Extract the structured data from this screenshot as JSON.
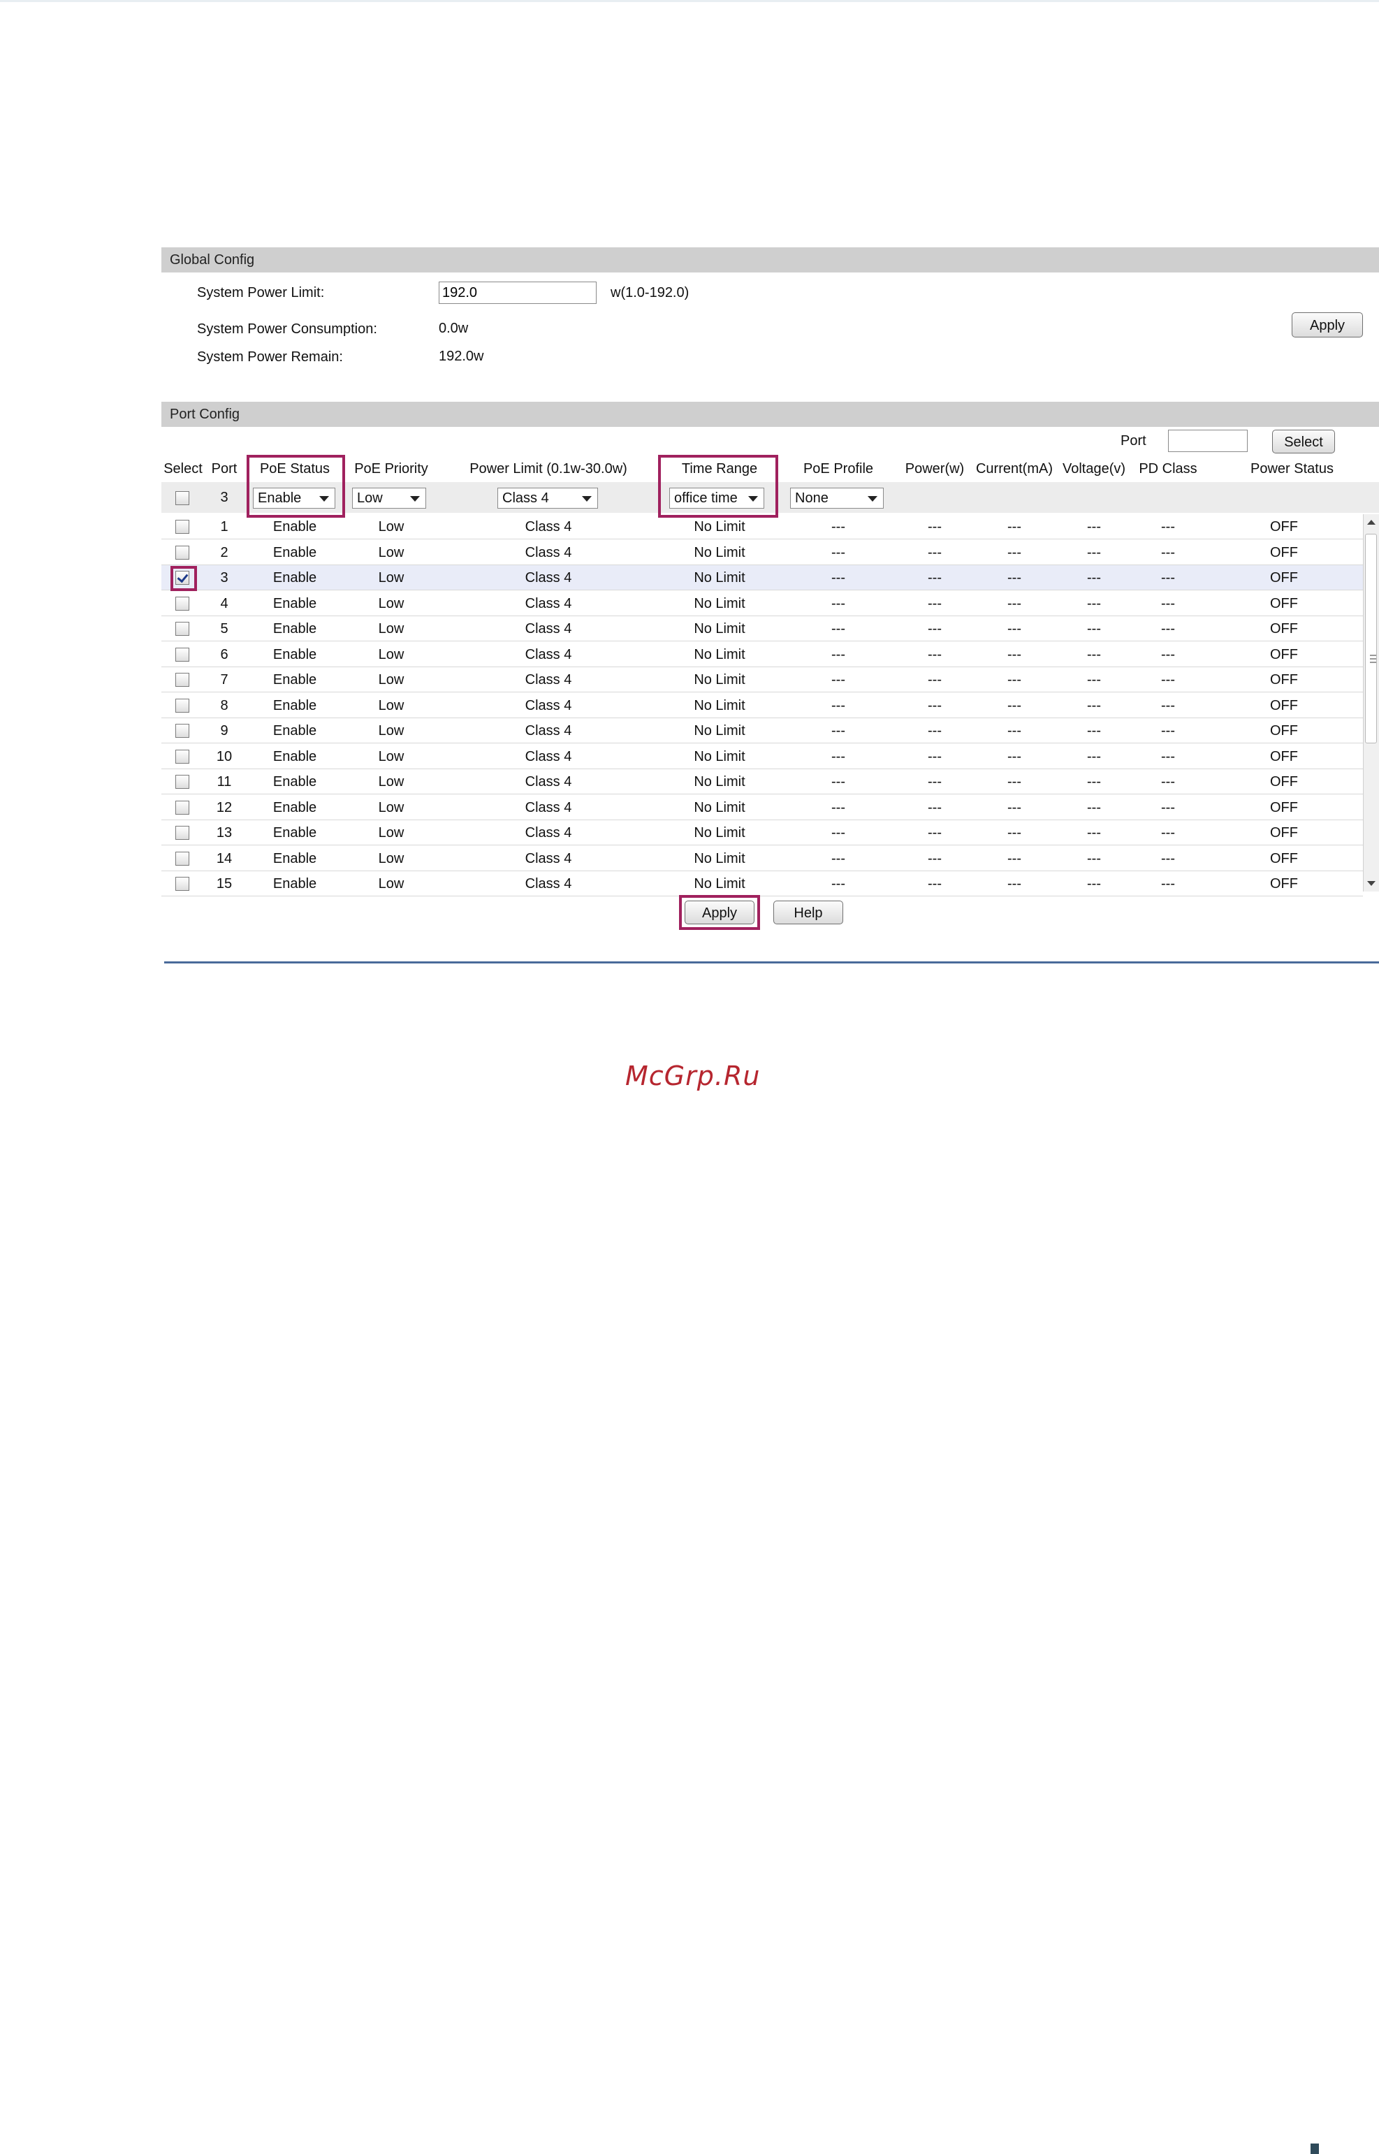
{
  "global_config": {
    "header": "Global Config",
    "system_power_limit_label": "System Power Limit:",
    "system_power_limit_value": "192.0",
    "system_power_limit_range": "w(1.0-192.0)",
    "system_power_consumption_label": "System Power Consumption:",
    "system_power_consumption_value": "0.0w",
    "system_power_remain_label": "System Power Remain:",
    "system_power_remain_value": "192.0w",
    "apply_label": "Apply"
  },
  "port_config": {
    "header": "Port Config",
    "port_filter_label": "Port",
    "port_filter_value": "",
    "select_label": "Select",
    "columns": [
      "Select",
      "Port",
      "PoE Status",
      "PoE Priority",
      "Power Limit (0.1w-30.0w)",
      "Time Range",
      "PoE Profile",
      "Power(w)",
      "Current(mA)",
      "Voltage(v)",
      "PD Class",
      "Power Status"
    ],
    "edit_row": {
      "port": "3",
      "poe_status": "Enable",
      "poe_priority": "Low",
      "power_limit": "Class 4",
      "time_range": "office time",
      "poe_profile": "None"
    },
    "rows": [
      {
        "port": "1",
        "status": "Enable",
        "priority": "Low",
        "limit": "Class 4",
        "time": "No Limit",
        "profile": "---",
        "power": "---",
        "current": "---",
        "voltage": "---",
        "pd_class": "---",
        "power_status": "OFF",
        "checked": false
      },
      {
        "port": "2",
        "status": "Enable",
        "priority": "Low",
        "limit": "Class 4",
        "time": "No Limit",
        "profile": "---",
        "power": "---",
        "current": "---",
        "voltage": "---",
        "pd_class": "---",
        "power_status": "OFF",
        "checked": false
      },
      {
        "port": "3",
        "status": "Enable",
        "priority": "Low",
        "limit": "Class 4",
        "time": "No Limit",
        "profile": "---",
        "power": "---",
        "current": "---",
        "voltage": "---",
        "pd_class": "---",
        "power_status": "OFF",
        "checked": true
      },
      {
        "port": "4",
        "status": "Enable",
        "priority": "Low",
        "limit": "Class 4",
        "time": "No Limit",
        "profile": "---",
        "power": "---",
        "current": "---",
        "voltage": "---",
        "pd_class": "---",
        "power_status": "OFF",
        "checked": false
      },
      {
        "port": "5",
        "status": "Enable",
        "priority": "Low",
        "limit": "Class 4",
        "time": "No Limit",
        "profile": "---",
        "power": "---",
        "current": "---",
        "voltage": "---",
        "pd_class": "---",
        "power_status": "OFF",
        "checked": false
      },
      {
        "port": "6",
        "status": "Enable",
        "priority": "Low",
        "limit": "Class 4",
        "time": "No Limit",
        "profile": "---",
        "power": "---",
        "current": "---",
        "voltage": "---",
        "pd_class": "---",
        "power_status": "OFF",
        "checked": false
      },
      {
        "port": "7",
        "status": "Enable",
        "priority": "Low",
        "limit": "Class 4",
        "time": "No Limit",
        "profile": "---",
        "power": "---",
        "current": "---",
        "voltage": "---",
        "pd_class": "---",
        "power_status": "OFF",
        "checked": false
      },
      {
        "port": "8",
        "status": "Enable",
        "priority": "Low",
        "limit": "Class 4",
        "time": "No Limit",
        "profile": "---",
        "power": "---",
        "current": "---",
        "voltage": "---",
        "pd_class": "---",
        "power_status": "OFF",
        "checked": false
      },
      {
        "port": "9",
        "status": "Enable",
        "priority": "Low",
        "limit": "Class 4",
        "time": "No Limit",
        "profile": "---",
        "power": "---",
        "current": "---",
        "voltage": "---",
        "pd_class": "---",
        "power_status": "OFF",
        "checked": false
      },
      {
        "port": "10",
        "status": "Enable",
        "priority": "Low",
        "limit": "Class 4",
        "time": "No Limit",
        "profile": "---",
        "power": "---",
        "current": "---",
        "voltage": "---",
        "pd_class": "---",
        "power_status": "OFF",
        "checked": false
      },
      {
        "port": "11",
        "status": "Enable",
        "priority": "Low",
        "limit": "Class 4",
        "time": "No Limit",
        "profile": "---",
        "power": "---",
        "current": "---",
        "voltage": "---",
        "pd_class": "---",
        "power_status": "OFF",
        "checked": false
      },
      {
        "port": "12",
        "status": "Enable",
        "priority": "Low",
        "limit": "Class 4",
        "time": "No Limit",
        "profile": "---",
        "power": "---",
        "current": "---",
        "voltage": "---",
        "pd_class": "---",
        "power_status": "OFF",
        "checked": false
      },
      {
        "port": "13",
        "status": "Enable",
        "priority": "Low",
        "limit": "Class 4",
        "time": "No Limit",
        "profile": "---",
        "power": "---",
        "current": "---",
        "voltage": "---",
        "pd_class": "---",
        "power_status": "OFF",
        "checked": false
      },
      {
        "port": "14",
        "status": "Enable",
        "priority": "Low",
        "limit": "Class 4",
        "time": "No Limit",
        "profile": "---",
        "power": "---",
        "current": "---",
        "voltage": "---",
        "pd_class": "---",
        "power_status": "OFF",
        "checked": false
      },
      {
        "port": "15",
        "status": "Enable",
        "priority": "Low",
        "limit": "Class 4",
        "time": "No Limit",
        "profile": "---",
        "power": "---",
        "current": "---",
        "voltage": "---",
        "pd_class": "---",
        "power_status": "OFF",
        "checked": false
      }
    ],
    "apply_label": "Apply",
    "help_label": "Help"
  },
  "watermark": "McGrp.Ru",
  "colors": {
    "highlight": "#a0215e",
    "header_bg": "#cfcfcf",
    "rule": "#4a6a9a",
    "watermark": "#b6262f"
  }
}
